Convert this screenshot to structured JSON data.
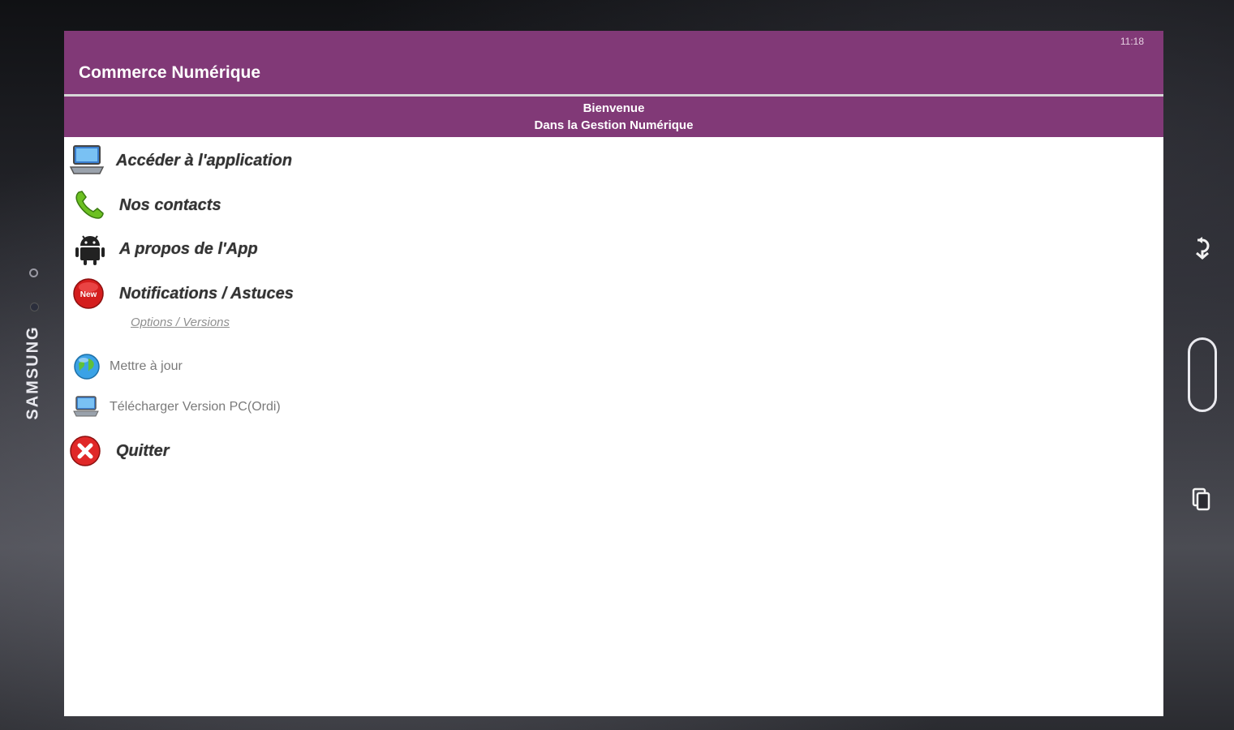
{
  "device": {
    "brand": "SAMSUNG"
  },
  "statusbar": {
    "time": "11:18"
  },
  "appbar": {
    "title": "Commerce Numérique"
  },
  "welcome": {
    "line1": "Bienvenue",
    "line2": "Dans la Gestion Numérique"
  },
  "menu": {
    "items": [
      {
        "label": "Accéder à l'application",
        "icon": "laptop-icon"
      },
      {
        "label": "Nos contacts",
        "icon": "phone-icon"
      },
      {
        "label": "A propos de l'App",
        "icon": "android-icon"
      },
      {
        "label": "Notifications / Astuces",
        "icon": "new-badge-icon",
        "badge": "New"
      }
    ],
    "section_link": "Options / Versions",
    "options": [
      {
        "label": "Mettre à jour",
        "icon": "globe-icon"
      },
      {
        "label": "Télécharger Version PC(Ordi)",
        "icon": "laptop-icon"
      }
    ],
    "quit": {
      "label": "Quitter",
      "icon": "close-icon"
    }
  },
  "colors": {
    "primary": "#813977",
    "background": "#ffffff",
    "text": "#333333"
  }
}
